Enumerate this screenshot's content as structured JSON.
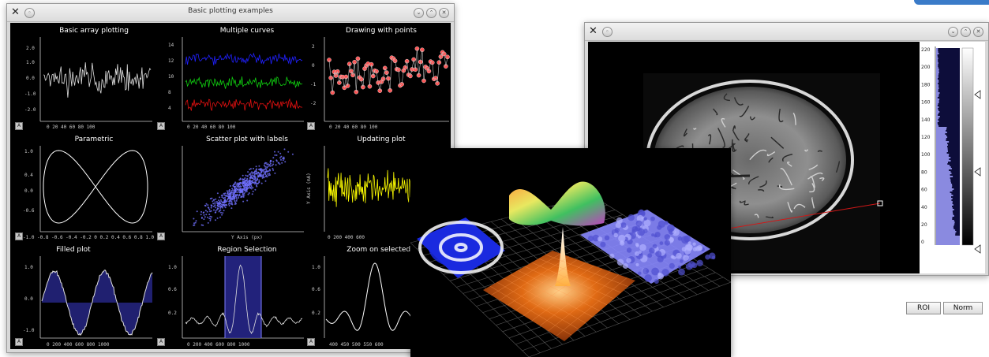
{
  "window1": {
    "title": "Basic plotting examples",
    "plots": [
      {
        "title": "Basic array plotting"
      },
      {
        "title": "Multiple curves"
      },
      {
        "title": "Drawing with points"
      },
      {
        "title": "Parametric"
      },
      {
        "title": "Scatter plot with labels"
      },
      {
        "title": "Updating plot"
      },
      {
        "title": "Filled plot"
      },
      {
        "title": "Region Selection"
      },
      {
        "title": "Zoom on selected r"
      }
    ],
    "auto_button_label": "A",
    "scatter_xlabel": "Y Axis (px)",
    "scatter_ylabel": "Y Axis (mA)"
  },
  "window2": {
    "roi_label": "ROI",
    "norm_label": "Norm",
    "histogram_ticks": [
      "220",
      "200",
      "180",
      "160",
      "140",
      "120",
      "100",
      "80",
      "60",
      "40",
      "20",
      "0"
    ]
  },
  "colors": {
    "plot_bg": "#000000",
    "curve_blue": "#2020ff",
    "curve_green": "#10d010",
    "curve_red": "#e01010",
    "curve_yellow": "#ffff00",
    "fill_navy": "#202070",
    "point_red": "#ff5050",
    "accent_blue": "#3a7bc8"
  }
}
